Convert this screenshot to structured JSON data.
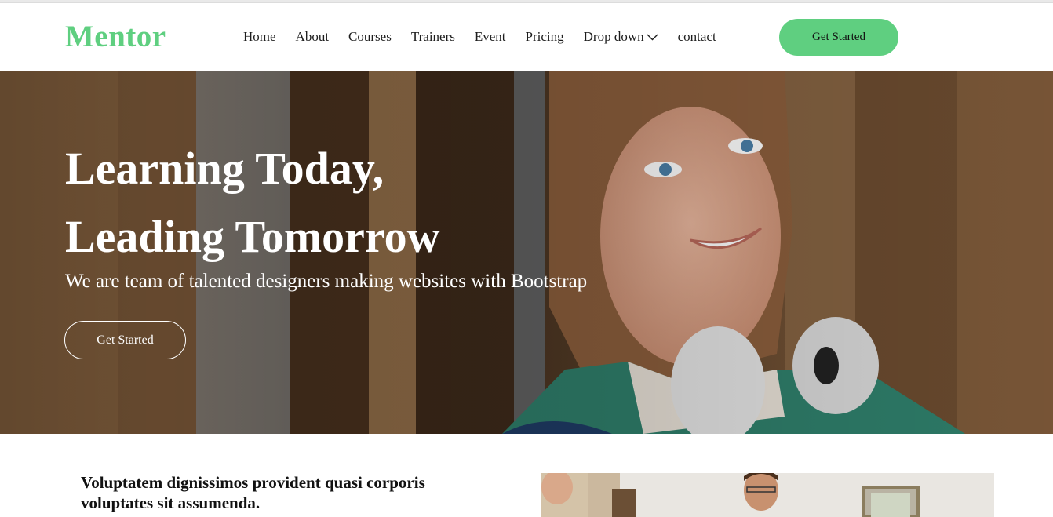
{
  "brand": {
    "name": "Mentor",
    "accent": "#5fcf80"
  },
  "nav": {
    "items": [
      "Home",
      "About",
      "Courses",
      "Trainers",
      "Event",
      "Pricing",
      "Drop down",
      "contact"
    ],
    "dropdown_icon": "chevron-down-icon"
  },
  "header_cta": "Get Started",
  "hero": {
    "title_line1": "Learning Today,",
    "title_line2": "Leading Tomorrow",
    "subtitle": "We are team of talented designers making websites with Bootstrap",
    "button": "Get Started",
    "image": "smiling student with headphones in front of wooden wall"
  },
  "about": {
    "heading": "Voluptatem dignissimos provident quasi corporis voluptates sit assumenda.",
    "image": "people working at a desk"
  }
}
